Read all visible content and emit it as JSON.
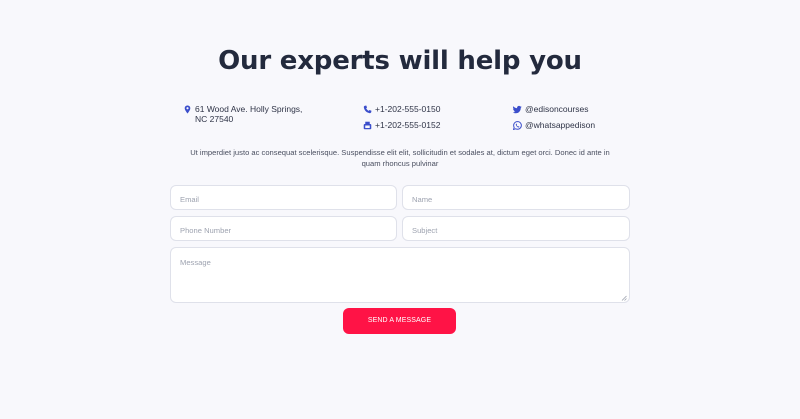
{
  "heading": "Our experts will help you",
  "contact": {
    "address": "61 Wood Ave. Holly Springs, NC 27540",
    "phone_1": "+1-202-555-0150",
    "phone_2": "+1-202-555-0152",
    "twitter": "@edisoncourses",
    "whatsapp": "@whatsappedison"
  },
  "description": "Ut imperdiet justo ac consequat scelerisque. Suspendisse elit elit, sollicitudin et sodales at, dictum eget orci. Donec id ante in quam rhoncus pulvinar",
  "form": {
    "email_placeholder": "Email",
    "name_placeholder": "Name",
    "phone_placeholder": "Phone Number",
    "subject_placeholder": "Subject",
    "message_placeholder": "Message",
    "submit_label": "SEND A MESSAGE"
  },
  "colors": {
    "accent": "#ff1346",
    "icon": "#3b4ecb",
    "background": "#f8f8fc"
  },
  "icons": [
    "location-icon",
    "phone-icon",
    "fax-icon",
    "twitter-icon",
    "whatsapp-icon"
  ]
}
